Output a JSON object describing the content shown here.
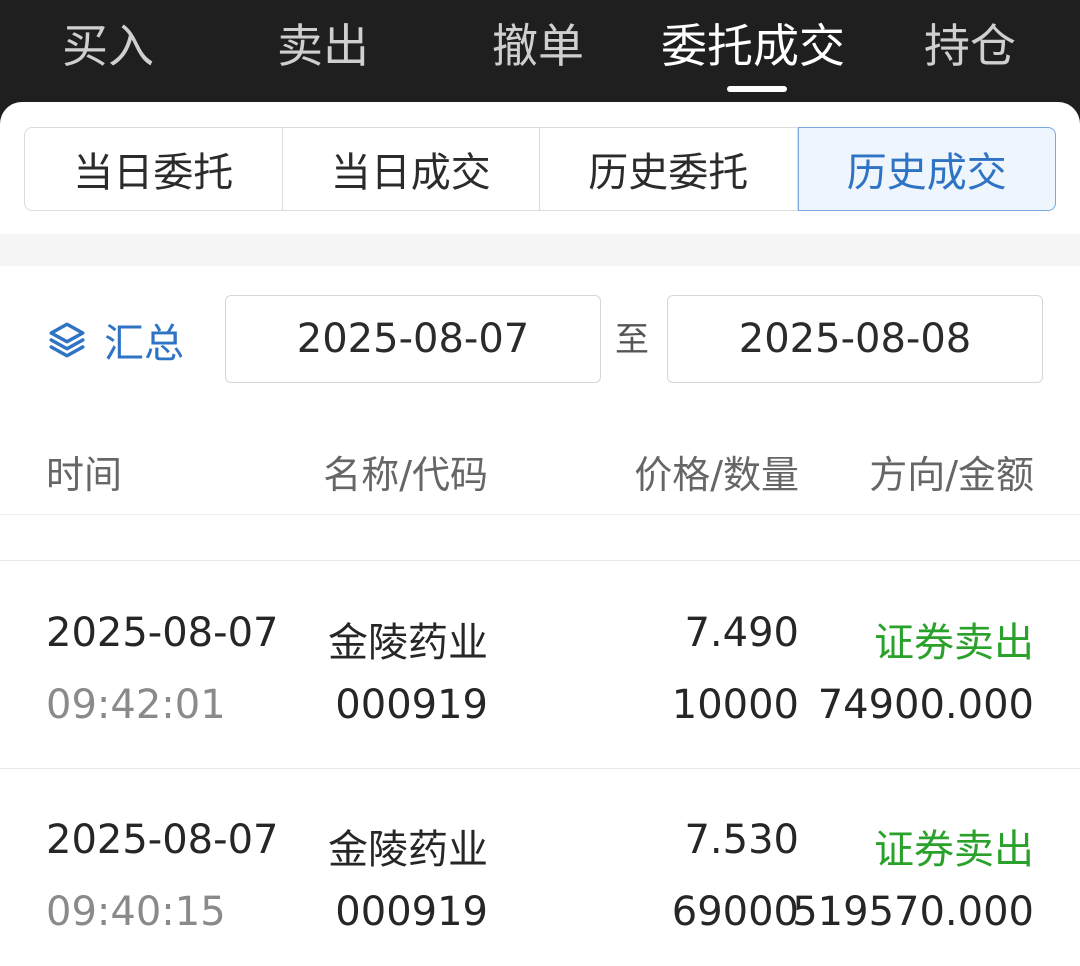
{
  "top_tabs": [
    {
      "label": "买入"
    },
    {
      "label": "卖出"
    },
    {
      "label": "撤单"
    },
    {
      "label": "委托成交",
      "active": true
    },
    {
      "label": "持仓"
    }
  ],
  "sub_tabs": [
    {
      "label": "当日委托"
    },
    {
      "label": "当日成交"
    },
    {
      "label": "历史委托"
    },
    {
      "label": "历史成交",
      "active": true
    }
  ],
  "filter": {
    "summary_label": "汇总",
    "start_date": "2025-08-07",
    "to_label": "至",
    "end_date": "2025-08-08"
  },
  "table": {
    "headers": [
      "时间",
      "名称/代码",
      "价格/数量",
      "方向/金额"
    ],
    "rows": [
      {
        "date": "2025-08-07",
        "time": "09:42:01",
        "name": "金陵药业",
        "code": "000919",
        "price": "7.490",
        "quantity": "10000",
        "direction": "证券卖出",
        "amount": "74900.000"
      },
      {
        "date": "2025-08-07",
        "time": "09:40:15",
        "name": "金陵药业",
        "code": "000919",
        "price": "7.530",
        "quantity": "69000",
        "direction": "证券卖出",
        "amount": "519570.000"
      }
    ]
  },
  "colors": {
    "accent": "#2f73c4",
    "sell": "#2aa12a",
    "dark_bg": "#1f1f1f"
  },
  "icons": {
    "summary": "layers-icon"
  }
}
